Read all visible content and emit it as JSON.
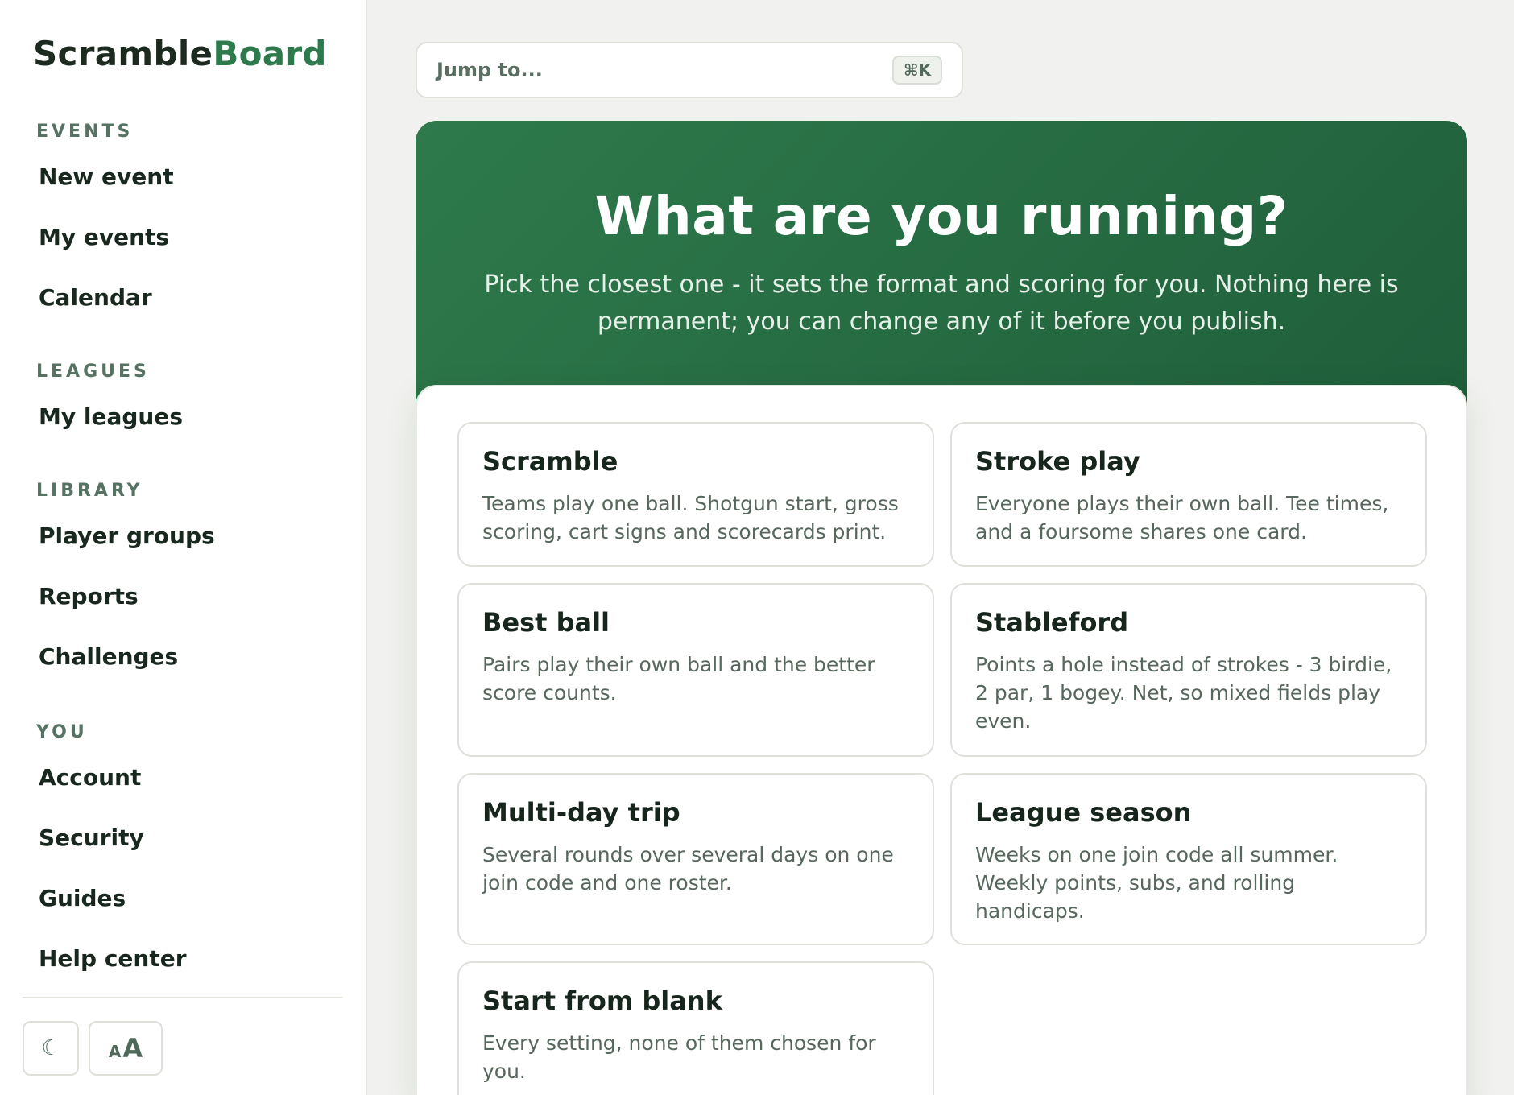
{
  "brand": {
    "part1": "Scramble",
    "part2": "Board"
  },
  "sidebar": {
    "events": {
      "label": "EVENTS",
      "items": [
        "New event",
        "My events",
        "Calendar"
      ]
    },
    "leagues": {
      "label": "LEAGUES",
      "items": [
        "My leagues"
      ]
    },
    "library": {
      "label": "LIBRARY",
      "items": [
        "Player groups",
        "Reports",
        "Challenges"
      ]
    },
    "you": {
      "label": "YOU",
      "items": [
        "Account",
        "Security",
        "Guides",
        "Help center"
      ]
    },
    "tools": {
      "theme_glyph": "☾",
      "text_small": "A",
      "text_large": "A"
    }
  },
  "search": {
    "placeholder": "Jump to...",
    "shortcut": "⌘K"
  },
  "hero": {
    "title": "What are you running?",
    "subtitle": "Pick the closest one - it sets the format and scoring for you. Nothing here is permanent; you can change any of it before you publish."
  },
  "formats": [
    {
      "title": "Scramble",
      "desc": "Teams play one ball. Shotgun start, gross scoring, cart signs and scorecards print."
    },
    {
      "title": "Stroke play",
      "desc": "Everyone plays their own ball. Tee times, and a foursome shares one card."
    },
    {
      "title": "Best ball",
      "desc": "Pairs play their own ball and the better score counts."
    },
    {
      "title": "Stableford",
      "desc": "Points a hole instead of strokes - 3 birdie, 2 par, 1 bogey. Net, so mixed fields play even."
    },
    {
      "title": "Multi-day trip",
      "desc": "Several rounds over several days on one join code and one roster."
    },
    {
      "title": "League season",
      "desc": "Weeks on one join code all summer. Weekly points, subs, and rolling handicaps."
    },
    {
      "title": "Start from blank",
      "desc": "Every setting, none of them chosen for you."
    }
  ],
  "colors": {
    "brand_green": "#2e7a4c",
    "hero_dark": "#1f5e3a",
    "text": "#1c2a20"
  }
}
